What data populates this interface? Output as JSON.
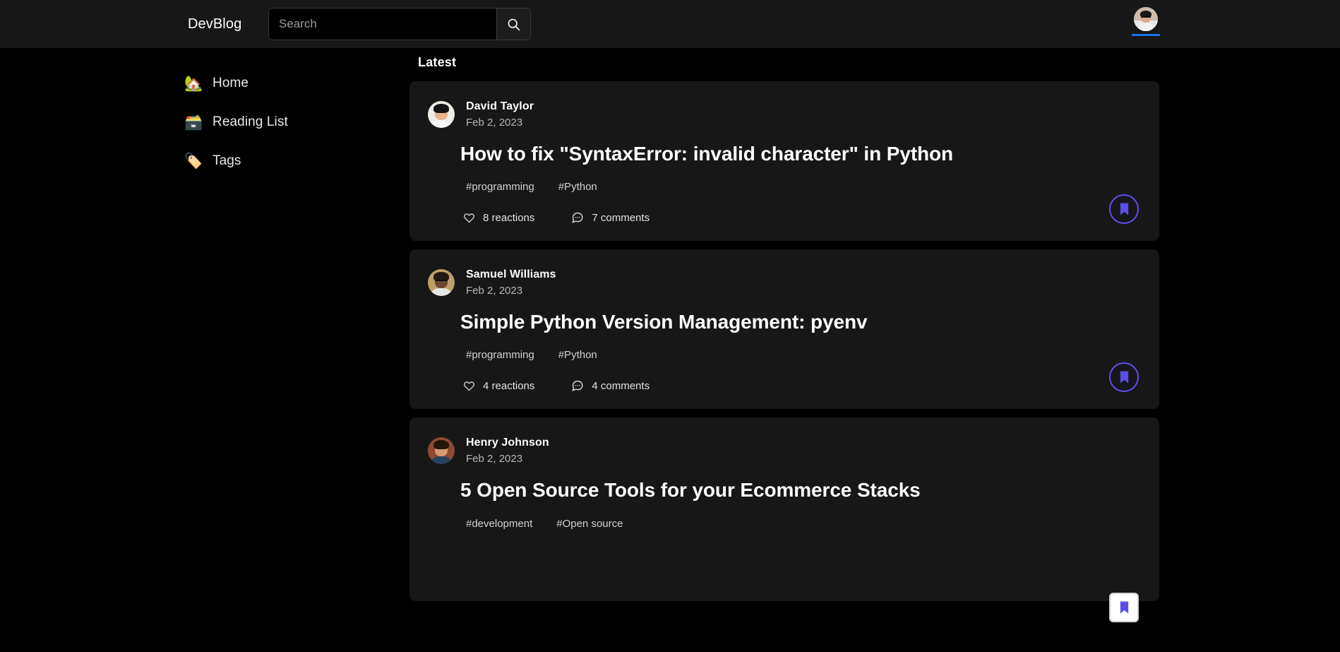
{
  "header": {
    "brand": "DevBlog",
    "search": {
      "placeholder": "Search",
      "value": "",
      "button_icon": "search-icon"
    },
    "account": {
      "icon": "user-avatar",
      "focused": true,
      "focus_color": "#1a73e8"
    }
  },
  "sidebar": {
    "items": [
      {
        "icon": "🏡",
        "icon_name": "house-icon",
        "label": "Home"
      },
      {
        "icon": "🗃️",
        "icon_name": "card-file-box-icon",
        "label": "Reading List"
      },
      {
        "icon": "🏷️",
        "icon_name": "tag-icon",
        "label": "Tags"
      }
    ]
  },
  "feed": {
    "heading": "Latest",
    "reaction_icon": "heart-icon",
    "comment_icon": "speech-bubble-icon",
    "bookmark_icon": "bookmark-icon",
    "accent_color": "#5b4fe8",
    "posts": [
      {
        "author": "David Taylor",
        "date": "Feb 2, 2023",
        "title": "How to fix \"SyntaxError: invalid character\" in Python",
        "tags": [
          "#programming",
          "#Python"
        ],
        "reactions": "8 reactions",
        "comments": "7 comments",
        "avatar": {
          "bg": "#f0ece6",
          "hair": "#141414",
          "face": "#e8b48e",
          "body": "#f5f5f5",
          "glasses": false
        }
      },
      {
        "author": "Samuel Williams",
        "date": "Feb 2, 2023",
        "title": "Simple Python Version Management: pyenv",
        "tags": [
          "#programming",
          "#Python"
        ],
        "reactions": "4 reactions",
        "comments": "4 comments",
        "avatar": {
          "bg": "#bda06a",
          "hair": "#241a12",
          "face": "#6b4730",
          "body": "#e6e6e6",
          "glasses": true
        }
      },
      {
        "author": "Henry Johnson",
        "date": "Feb 2, 2023",
        "title": "5 Open Source Tools for your Ecommerce Stacks",
        "tags": [
          "#development",
          "#Open source"
        ],
        "reactions": "",
        "comments": "",
        "avatar": {
          "bg": "#8d4a33",
          "hair": "#241708",
          "face": "#d79b72",
          "body": "#27405e",
          "glasses": false
        }
      }
    ]
  }
}
